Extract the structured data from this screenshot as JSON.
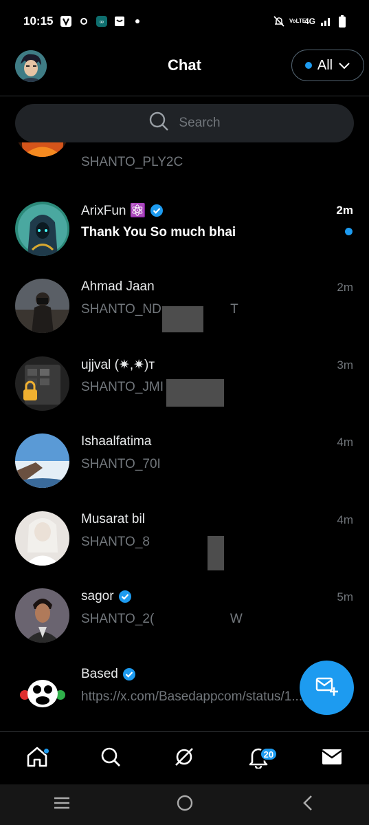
{
  "status_bar": {
    "time": "10:15",
    "network": "4G",
    "volte": "VoLTE"
  },
  "header": {
    "title": "Chat",
    "filter_label": "All",
    "accent": "#1d9bf0"
  },
  "search": {
    "placeholder": "Search"
  },
  "conversations": [
    {
      "name": "",
      "message": "SHANTO_PLY2C",
      "time": "",
      "avatar": "fiery-warrior"
    },
    {
      "name": "ArixFun ⚛️",
      "message": "Thank You So much bhai",
      "time": "2m",
      "verified": true,
      "unread": true,
      "avatar": "hooded-figure"
    },
    {
      "name": "Ahmad Jaan",
      "message": "SHANTO_ND",
      "message_tail": "T",
      "time": "2m",
      "avatar": "photographer"
    },
    {
      "name": "ujjval (✷,✷)т",
      "message": "SHANTO_JMI",
      "time": "3m",
      "avatar": "phone-lock"
    },
    {
      "name": "Ishaalfatima",
      "message": "SHANTO_70I",
      "time": "4m",
      "avatar": "cliff-sea"
    },
    {
      "name": "Musarat bil",
      "message": "SHANTO_8",
      "time": "4m",
      "avatar": "bride"
    },
    {
      "name": "sagor",
      "message": "SHANTO_2(",
      "message_tail": "W",
      "time": "5m",
      "verified": true,
      "avatar": "man-portrait"
    },
    {
      "name": "Based",
      "message": "https://x.com/Basedappcom/status/1...",
      "time": "",
      "verified": true,
      "avatar": "monkey-logo"
    }
  ],
  "tabbar": {
    "notification_count": "20"
  }
}
